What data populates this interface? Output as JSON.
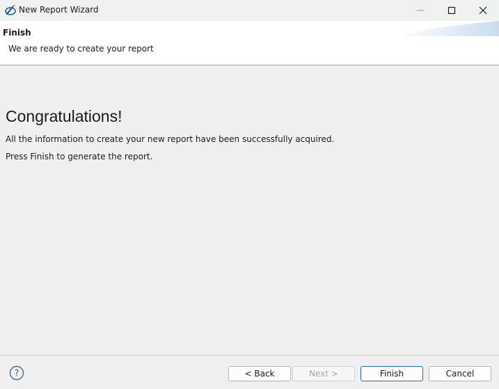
{
  "window": {
    "title": "New Report Wizard",
    "icon": "eclipse-birt-icon"
  },
  "header": {
    "title": "Finish",
    "description": "We are ready to create your report"
  },
  "content": {
    "heading": "Congratulations!",
    "line1": "All the information to create your new report have been successfully acquired.",
    "line2": "Press Finish to generate the report."
  },
  "footer": {
    "back_label": "< Back",
    "next_label": "Next >",
    "finish_label": "Finish",
    "cancel_label": "Cancel"
  },
  "colors": {
    "accent": "#1c6fc5",
    "titlebar": "#eef3f0",
    "header_bg": "#ffffff",
    "body_bg": "#f0f0f0"
  }
}
